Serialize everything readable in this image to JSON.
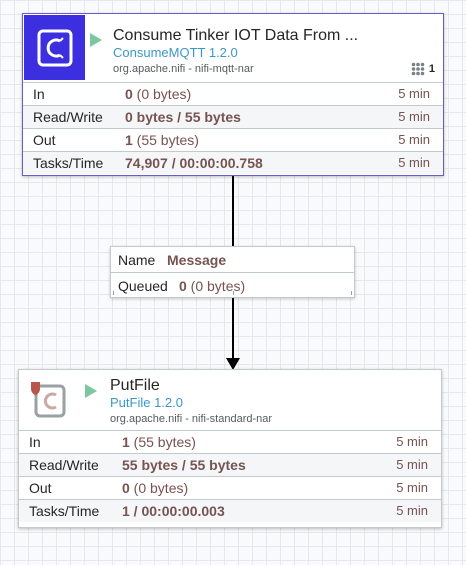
{
  "processors": [
    {
      "name": "Consume Tinker IOT Data From ...",
      "type": "ConsumeMQTT 1.2.0",
      "bundle": "org.apache.nifi - nifi-mqtt-nar",
      "threads": "1",
      "run_state": "running",
      "icon": "processor-icon",
      "stats": {
        "in": {
          "label": "In",
          "value": "0",
          "detail": " (0 bytes)",
          "age": "5 min"
        },
        "read_write": {
          "label": "Read/Write",
          "value": "0 bytes / 55 bytes",
          "detail": "",
          "age": "5 min"
        },
        "out": {
          "label": "Out",
          "value": "1",
          "detail": " (55 bytes)",
          "age": "5 min"
        },
        "tasks_time": {
          "label": "Tasks/Time",
          "value": "74,907 / 00:00:00.758",
          "detail": "",
          "age": "5 min"
        }
      }
    },
    {
      "name": "PutFile",
      "type": "PutFile 1.2.0",
      "bundle": "org.apache.nifi - nifi-standard-nar",
      "run_state": "running",
      "icon": "processor-icon",
      "restricted_icon": "shield-icon",
      "stats": {
        "in": {
          "label": "In",
          "value": "1",
          "detail": " (55 bytes)",
          "age": "5 min"
        },
        "read_write": {
          "label": "Read/Write",
          "value": "55 bytes / 55 bytes",
          "detail": "",
          "age": "5 min"
        },
        "out": {
          "label": "Out",
          "value": "0",
          "detail": " (0 bytes)",
          "age": "5 min"
        },
        "tasks_time": {
          "label": "Tasks/Time",
          "value": "1 / 00:00:00.003",
          "detail": "",
          "age": "5 min"
        }
      }
    }
  ],
  "connection": {
    "name_label": "Name",
    "name": "Message",
    "queued_label": "Queued",
    "queued_count": "0",
    "queued_detail": " (0 bytes)"
  },
  "colors": {
    "selected_icon_bg": "#3b2fe0",
    "run_indicator": "#7dc7a0",
    "type_text": "#3a98c9",
    "stat_value": "#775351"
  }
}
